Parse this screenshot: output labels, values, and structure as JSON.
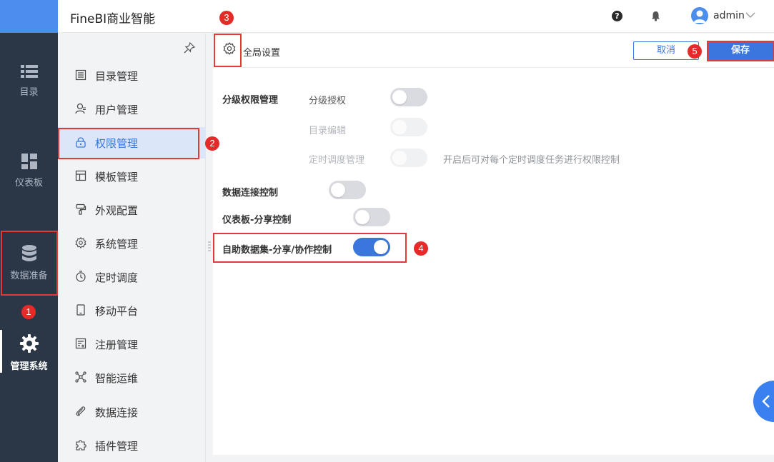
{
  "app": {
    "title": "FineBI商业智能"
  },
  "user": {
    "name": "admin"
  },
  "rail": {
    "items": [
      {
        "label": "目录",
        "icon": "list-icon"
      },
      {
        "label": "仪表板",
        "icon": "dashboard-icon"
      },
      {
        "label": "数据准备",
        "icon": "database-icon"
      },
      {
        "label": "管理系统",
        "icon": "gear-icon"
      }
    ]
  },
  "subnav": {
    "items": [
      {
        "label": "目录管理",
        "icon": "catalog-icon"
      },
      {
        "label": "用户管理",
        "icon": "user-icon"
      },
      {
        "label": "权限管理",
        "icon": "lock-icon"
      },
      {
        "label": "模板管理",
        "icon": "template-icon"
      },
      {
        "label": "外观配置",
        "icon": "brush-icon"
      },
      {
        "label": "系统管理",
        "icon": "settings-icon"
      },
      {
        "label": "定时调度",
        "icon": "timer-icon"
      },
      {
        "label": "移动平台",
        "icon": "mobile-icon"
      },
      {
        "label": "注册管理",
        "icon": "register-icon"
      },
      {
        "label": "智能运维",
        "icon": "network-icon"
      },
      {
        "label": "数据连接",
        "icon": "paperclip-icon"
      },
      {
        "label": "插件管理",
        "icon": "puzzle-icon"
      }
    ]
  },
  "toolbar": {
    "global_settings": "全局设置",
    "cancel": "取消",
    "save": "保存"
  },
  "settings": {
    "group_label": "分级权限管理",
    "graded_auth": "分级授权",
    "catalog_edit": "目录编辑",
    "schedule_manage": "定时调度管理",
    "schedule_hint": "开启后可对每个定时调度任务进行权限控制",
    "data_conn": "数据连接控制",
    "dashboard_share": "仪表板-分享控制",
    "self_dataset": "自助数据集-分享/协作控制"
  },
  "annotations": [
    "1",
    "2",
    "3",
    "4",
    "5"
  ],
  "colors": {
    "accent": "#3a76dd",
    "rail_bg": "#2b3647",
    "annotation": "#e53935"
  }
}
